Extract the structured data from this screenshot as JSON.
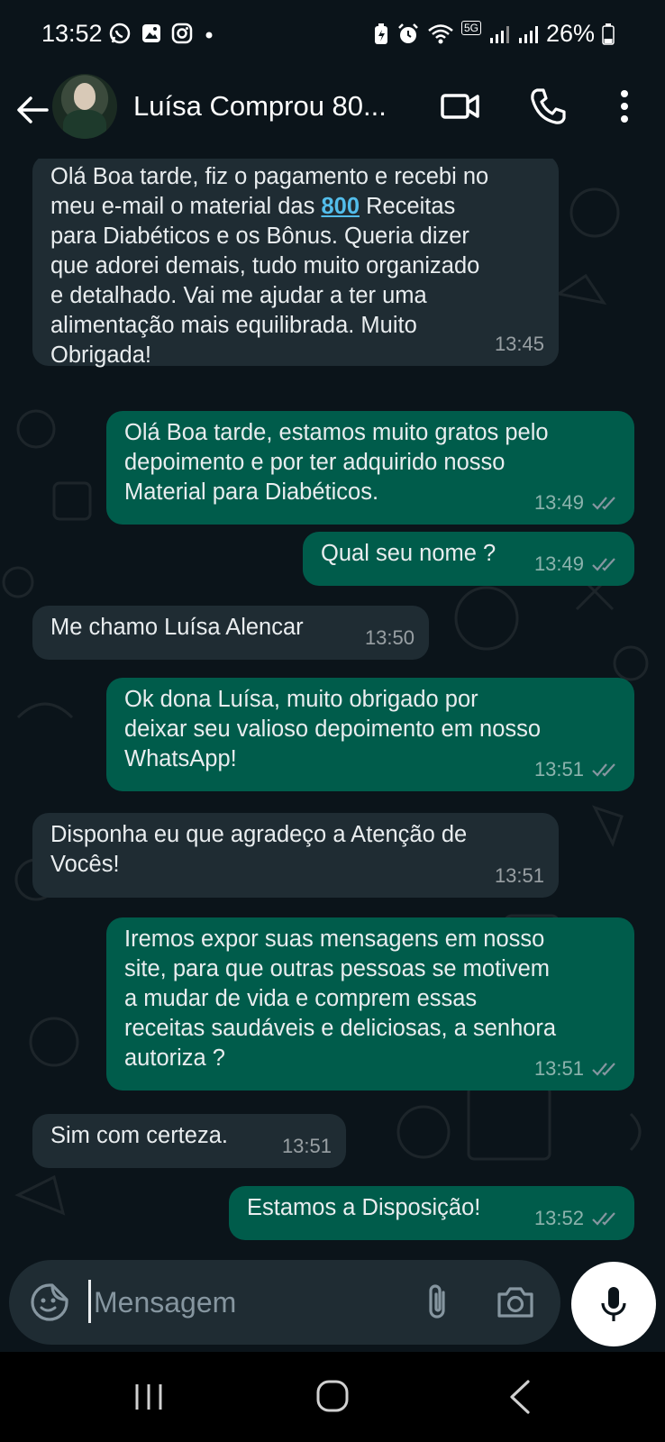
{
  "status_bar": {
    "time": "13:52",
    "network_label": "5G",
    "battery": "26%"
  },
  "header": {
    "contact_name": "Luísa Comprou 80...",
    "icons": [
      "back-arrow-icon",
      "video-call-icon",
      "phone-icon",
      "more-vert-icon"
    ]
  },
  "messages": [
    {
      "direction": "in",
      "text_before": "Olá Boa tarde, fiz o pagamento e recebi no\nmeu e-mail  o material das ",
      "link": "800",
      "text_after": " Receitas\npara Diabéticos e os Bônus. Queria dizer\nque adorei demais, tudo muito organizado\ne detalhado. Vai me ajudar a ter uma\nalimentação mais equilibrada. Muito\nObrigada!",
      "time": "13:45"
    },
    {
      "direction": "out",
      "text": "Olá Boa tarde, estamos muito gratos pelo\ndepoimento e por ter adquirido nosso\nMaterial para Diabéticos.",
      "time": "13:49",
      "read": true
    },
    {
      "direction": "out",
      "text": "Qual seu nome ?",
      "time": "13:49",
      "read": true
    },
    {
      "direction": "in",
      "text": "Me chamo Luísa Alencar",
      "time": "13:50"
    },
    {
      "direction": "out",
      "text": "Ok dona Luísa, muito obrigado por\ndeixar seu valioso depoimento em nosso\nWhatsApp!",
      "time": "13:51",
      "read": true
    },
    {
      "direction": "in",
      "text": "Disponha eu que agradeço a Atenção de\nVocês!",
      "time": "13:51"
    },
    {
      "direction": "out",
      "text": "Iremos expor suas mensagens em nosso\nsite, para que outras pessoas se motivem\na mudar de vida e comprem essas\nreceitas saudáveis e deliciosas, a senhora\nautoriza ?",
      "time": "13:51",
      "read": true
    },
    {
      "direction": "in",
      "text": "Sim com certeza.",
      "time": "13:51"
    },
    {
      "direction": "out",
      "text": "Estamos a Disposição!",
      "time": "13:52",
      "read": true
    }
  ],
  "composer": {
    "placeholder": "Mensagem",
    "icons": [
      "sticker-icon",
      "attach-icon",
      "camera-icon",
      "mic-icon"
    ]
  },
  "colors": {
    "background": "#0b141a",
    "incoming_bubble": "#1f2c33",
    "outgoing_bubble": "#005c4b",
    "link": "#53bdeb",
    "read_ticks": "#8696a0"
  }
}
